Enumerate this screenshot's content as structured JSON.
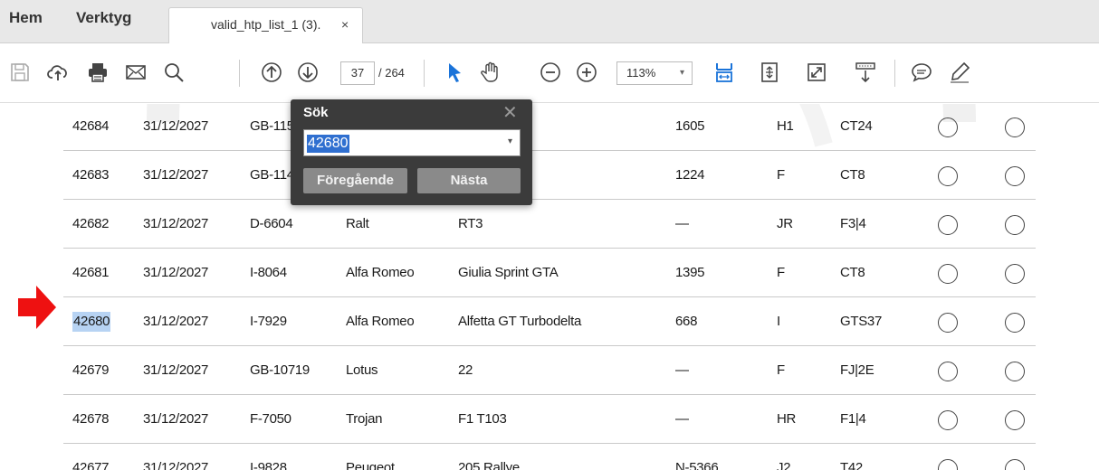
{
  "tabs": {
    "home": "Hem",
    "tools": "Verktyg",
    "document": "valid_htp_list_1 (3).",
    "close": "×"
  },
  "toolbar": {
    "page_current": "37",
    "page_total": "/ 264",
    "zoom": "113%",
    "zoom_caret": "▾"
  },
  "search": {
    "label": "Sök",
    "close": "✕",
    "value": "42680",
    "dropdown": "▾",
    "prev": "Föregående",
    "next": "Nästa"
  },
  "rows": [
    [
      "42684",
      "31/12/2027",
      "GB-115",
      "",
      "00",
      "1605",
      "H1",
      "CT24"
    ],
    [
      "42683",
      "31/12/2027",
      "GB-114",
      "",
      "ina Lotus",
      "1224",
      "F",
      "CT8"
    ],
    [
      "42682",
      "31/12/2027",
      "D-6604",
      "Ralt",
      "RT3",
      "—",
      "JR",
      "F3|4"
    ],
    [
      "42681",
      "31/12/2027",
      "I-8064",
      "Alfa Romeo",
      "Giulia Sprint GTA",
      "1395",
      "F",
      "CT8"
    ],
    [
      "42680",
      "31/12/2027",
      "I-7929",
      "Alfa Romeo",
      "Alfetta GT Turbodelta",
      "668",
      "I",
      "GTS37"
    ],
    [
      "42679",
      "31/12/2027",
      "GB-10719",
      "Lotus",
      "22",
      "—",
      "F",
      "FJ|2E"
    ],
    [
      "42678",
      "31/12/2027",
      "F-7050",
      "Trojan",
      "F1 T103",
      "—",
      "HR",
      "F1|4"
    ],
    [
      "42677",
      "31/12/2027",
      "I-9828",
      "Peugeot",
      "205 Rallye",
      "N-5366",
      "J2",
      "T42"
    ]
  ],
  "colors": {
    "arrow": "#ee1111",
    "accent_blue": "#1a73d9",
    "highlight": "#b7d3f3"
  }
}
